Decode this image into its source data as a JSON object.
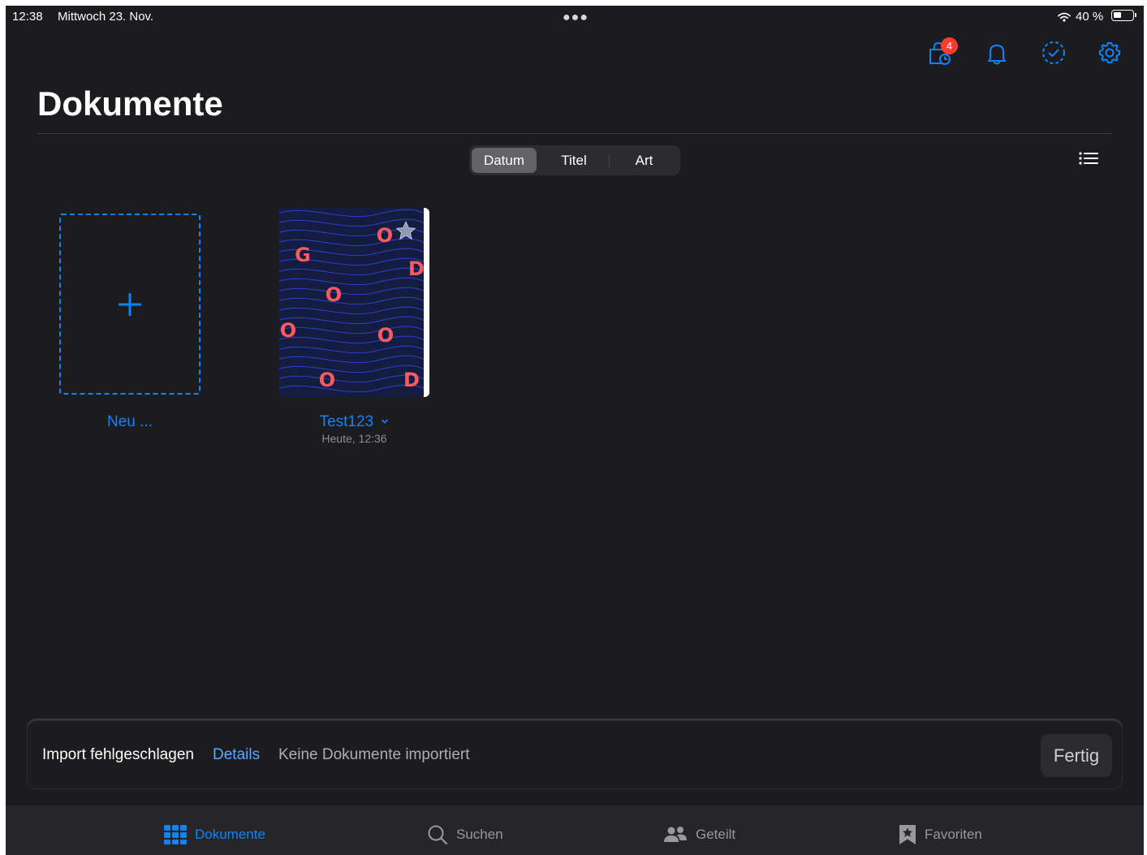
{
  "status_bar": {
    "time": "12:38",
    "date": "Mittwoch 23. Nov.",
    "battery": "40 %",
    "battery_level": 0.4,
    "icons": [
      "wifi-icon",
      "battery-icon"
    ]
  },
  "toolbar": {
    "badge_count": "4",
    "icons": [
      "bag-clock-icon",
      "bell-icon",
      "checkmark-circle-dashed-icon",
      "gear-icon"
    ]
  },
  "page": {
    "title": "Dokumente"
  },
  "sort": {
    "options": [
      "Datum",
      "Titel",
      "Art"
    ],
    "selected": "Datum"
  },
  "documents": {
    "new_label": "Neu ...",
    "items": [
      {
        "name": "Test123",
        "date": "Heute, 12:36",
        "cover_letters": [
          "O",
          "G",
          "D",
          "O",
          "O",
          "O",
          "O",
          "D"
        ]
      }
    ]
  },
  "import_banner": {
    "title": "Import fehlgeschlagen",
    "details_label": "Details",
    "message": "Keine Dokumente importiert",
    "done_label": "Fertig"
  },
  "tabbar": {
    "tabs": [
      {
        "label": "Dokumente",
        "icon": "grid-icon",
        "active": true
      },
      {
        "label": "Suchen",
        "icon": "magnifier-icon",
        "active": false
      },
      {
        "label": "Geteilt",
        "icon": "people-icon",
        "active": false
      },
      {
        "label": "Favoriten",
        "icon": "bookmark-star-icon",
        "active": false
      }
    ]
  },
  "colors": {
    "accent": "#0a84ff",
    "background": "#1c1c1e",
    "badge": "#ff3b30",
    "cover_bg": "#141c3f",
    "cover_letters": "#ff5a5f"
  }
}
